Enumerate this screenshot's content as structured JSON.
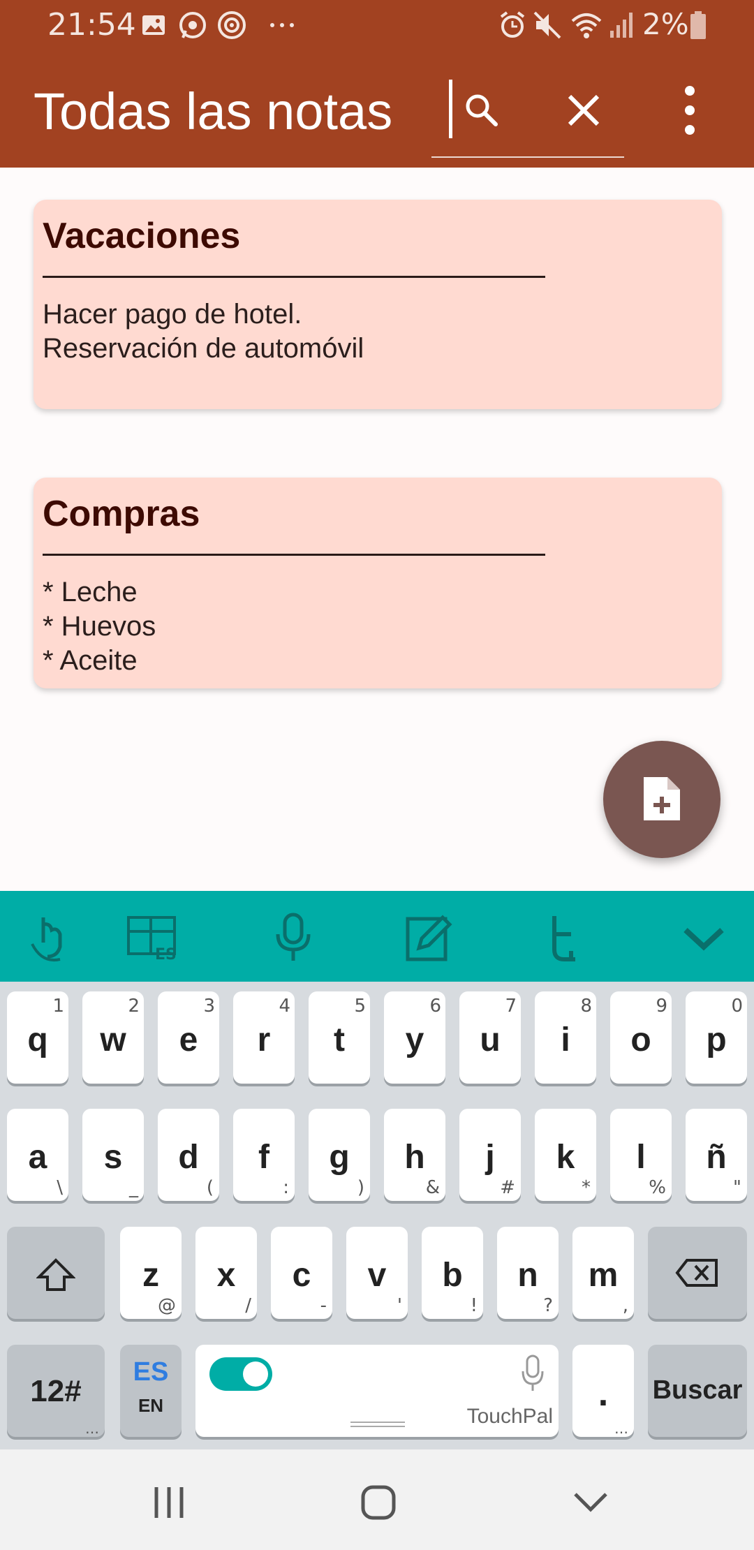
{
  "status_bar": {
    "time": "21:54",
    "battery": "2%",
    "icons": [
      "image-icon",
      "whatsapp-icon",
      "target-icon",
      "more-dots-icon",
      "alarm-icon",
      "mute-icon",
      "wifi-icon",
      "signal-icon",
      "battery-icon"
    ]
  },
  "app_bar": {
    "title": "Todas las notas",
    "search_placeholder": "",
    "color": "#A24221"
  },
  "notes": [
    {
      "title": "Vacaciones",
      "body": "Hacer pago de hotel.\nReservación de automóvil"
    },
    {
      "title": "Compras",
      "body": "* Leche\n* Huevos\n* Aceite"
    }
  ],
  "colors": {
    "card": "#FFDAD1",
    "fab": "#7A5651",
    "keyboard_toolbar": "#00ADA6"
  },
  "keyboard": {
    "row1": [
      {
        "k": "q",
        "h": "1"
      },
      {
        "k": "w",
        "h": "2"
      },
      {
        "k": "e",
        "h": "3"
      },
      {
        "k": "r",
        "h": "4"
      },
      {
        "k": "t",
        "h": "5"
      },
      {
        "k": "y",
        "h": "6"
      },
      {
        "k": "u",
        "h": "7"
      },
      {
        "k": "i",
        "h": "8"
      },
      {
        "k": "o",
        "h": "9"
      },
      {
        "k": "p",
        "h": "0"
      }
    ],
    "row2": [
      {
        "k": "a",
        "h": "\\"
      },
      {
        "k": "s",
        "h": "_"
      },
      {
        "k": "d",
        "h": "("
      },
      {
        "k": "f",
        "h": ":"
      },
      {
        "k": "g",
        "h": ")"
      },
      {
        "k": "h",
        "h": "&"
      },
      {
        "k": "j",
        "h": "#"
      },
      {
        "k": "k",
        "h": "*"
      },
      {
        "k": "l",
        "h": "%"
      },
      {
        "k": "ñ",
        "h": "\""
      }
    ],
    "row3": [
      {
        "k": "z",
        "h": "@"
      },
      {
        "k": "x",
        "h": "/"
      },
      {
        "k": "c",
        "h": "-"
      },
      {
        "k": "v",
        "h": "'"
      },
      {
        "k": "b",
        "h": "!"
      },
      {
        "k": "n",
        "h": "?"
      },
      {
        "k": "m",
        "h": ","
      }
    ],
    "symbols_key": "12#",
    "lang_primary": "ES",
    "lang_secondary": "EN",
    "space_label": "TouchPal",
    "period_key": ".",
    "action_key": "Buscar",
    "toolbar_icons": [
      "touchpal-gesture-icon",
      "layout-es-icon",
      "microphone-icon",
      "edit-note-icon",
      "emoji-twitter-icon",
      "collapse-chevron-icon"
    ]
  }
}
